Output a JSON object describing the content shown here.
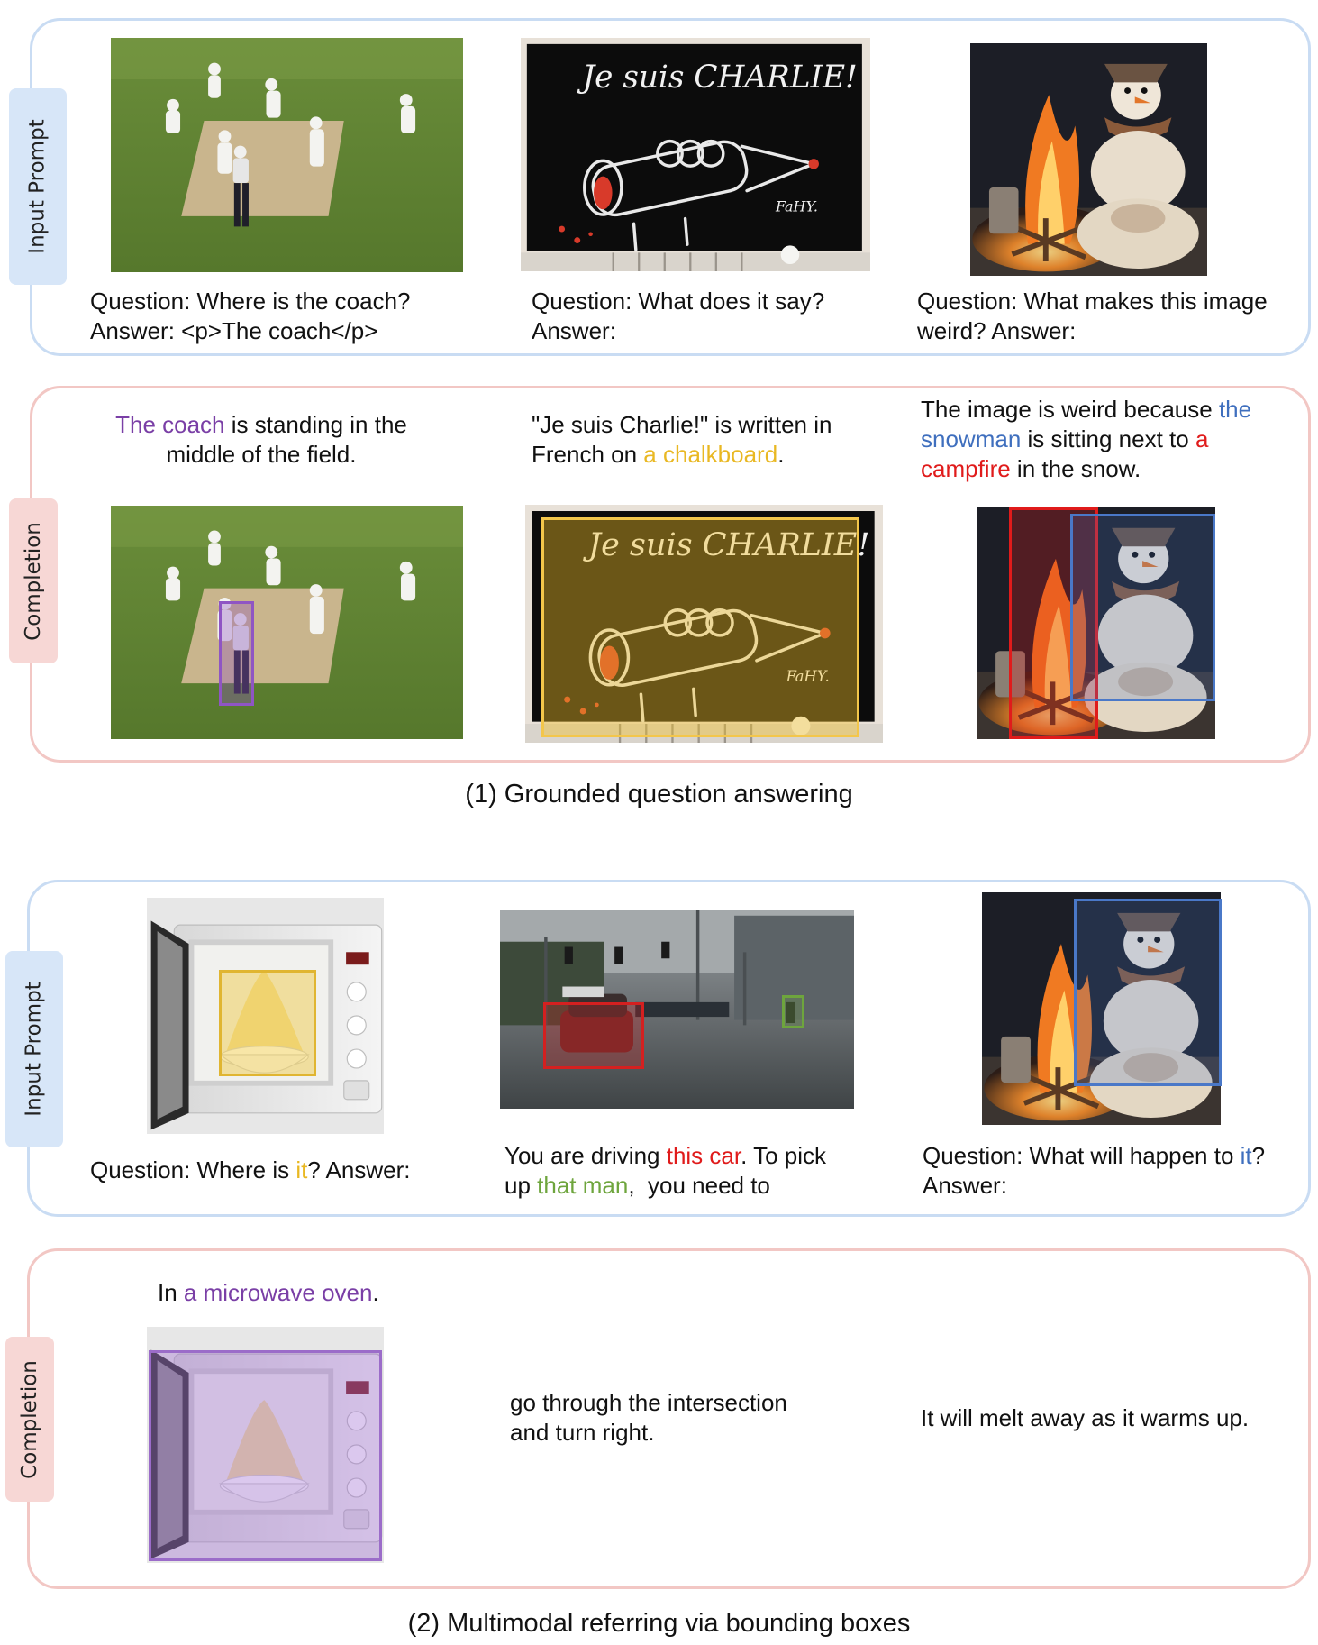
{
  "panel_labels": {
    "input": "Input Prompt",
    "completion": "Completion"
  },
  "colors": {
    "input_border": "#c9dcf3",
    "completion_border": "#f2c7c4",
    "purple": "#7a3fa6",
    "yellow": "#e9b823",
    "blue": "#3f6fbe",
    "red": "#e01b1b",
    "green": "#6ea53d"
  },
  "section1": {
    "caption": "(1) Grounded question answering",
    "inputs": [
      {
        "image": "cricket-field-photo",
        "line1": "Question: Where is the coach?",
        "line2": "Answer: <p>The coach</p>"
      },
      {
        "image": "je-suis-charlie-chalkboard",
        "line1": "Question: What does it say?",
        "line2": "Answer:"
      },
      {
        "image": "snowman-by-campfire",
        "line1": "Question: What makes this image",
        "line2": "weird? Answer:"
      }
    ],
    "completions": [
      {
        "hl": "The coach",
        "rest1": " is standing in the",
        "line2": "middle of the field."
      },
      {
        "line1": "\"Je suis Charlie!\" is written in",
        "pre": "French on ",
        "hl": "a chalkboard",
        "post": "."
      },
      {
        "pre": "The image is weird because ",
        "hl_blue_a": "the",
        "hl_blue_b": "snowman",
        "mid": " is sitting next to ",
        "hl_red_a": "a",
        "hl_red_b": "campfire",
        "post": " in the snow."
      }
    ],
    "chalk_text": "Je suis CHARLIE!",
    "chalk_signature": "FaHY."
  },
  "section2": {
    "caption": "(2) Multimodal referring via bounding boxes",
    "inputs": [
      {
        "image": "microwave-with-dessert",
        "pre": "Question: Where is ",
        "hl": "it",
        "post": "? Answer:"
      },
      {
        "image": "street-intersection-car",
        "pre1": "You are driving ",
        "hl1": "this car",
        "post1": ". To pick",
        "pre2": "up ",
        "hl2": "that man",
        "post2": ",  you need to"
      },
      {
        "image": "snowman-by-campfire",
        "pre": "Question: What will happen to ",
        "hl": "it",
        "post": "?",
        "line2": "Answer:"
      }
    ],
    "completions": [
      {
        "pre": "In ",
        "hl": "a microwave oven",
        "post": "."
      },
      {
        "line1": "go through the intersection",
        "line2": "and turn right."
      },
      {
        "line1": "It will melt away as it warms up."
      }
    ]
  }
}
